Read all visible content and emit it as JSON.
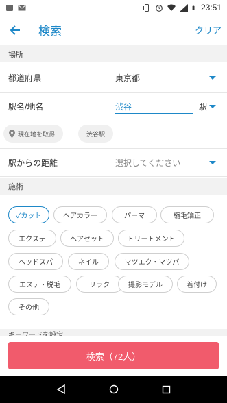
{
  "status_bar": {
    "time": "23:51",
    "icons": [
      "notification-icon",
      "gmail-icon",
      "vibrate-icon",
      "alarm-icon",
      "wifi-icon",
      "signal-icon",
      "battery-icon"
    ]
  },
  "app_bar": {
    "title": "検索",
    "clear_label": "クリア",
    "back_icon": "arrow-back-icon"
  },
  "sections": {
    "location": "場所",
    "treatment": "施術",
    "more": "キーワードを設定"
  },
  "location": {
    "prefecture_label": "都道府県",
    "prefecture_value": "東京都",
    "station_label": "駅名/地名",
    "station_value": "渋谷",
    "station_suffix": "駅",
    "current_location_chip": "現在地を取得",
    "station_chip": "渋谷駅",
    "distance_label": "駅からの距離",
    "distance_placeholder": "選択してください"
  },
  "treatments": [
    {
      "label": "✓カット",
      "selected": true
    },
    {
      "label": "ヘアカラー",
      "selected": false
    },
    {
      "label": "パーマ",
      "selected": false
    },
    {
      "label": "縮毛矯正",
      "selected": false
    },
    {
      "label": "エクステ",
      "selected": false
    },
    {
      "label": "ヘアセット",
      "selected": false
    },
    {
      "label": "トリートメント",
      "selected": false
    },
    {
      "label": "ヘッドスパ",
      "selected": false
    },
    {
      "label": "ネイル",
      "selected": false
    },
    {
      "label": "マツエク・マツパ",
      "selected": false
    },
    {
      "label": "エステ・脱毛",
      "selected": false
    },
    {
      "label": "リラク",
      "selected": false
    },
    {
      "label": "撮影モデル",
      "selected": false
    },
    {
      "label": "着付け",
      "selected": false
    },
    {
      "label": "その他",
      "selected": false
    }
  ],
  "search_button": "検索（72人）",
  "colors": {
    "accent": "#1e88c8",
    "search_button": "#f15b6c",
    "section_bg": "#f2f2f2"
  }
}
